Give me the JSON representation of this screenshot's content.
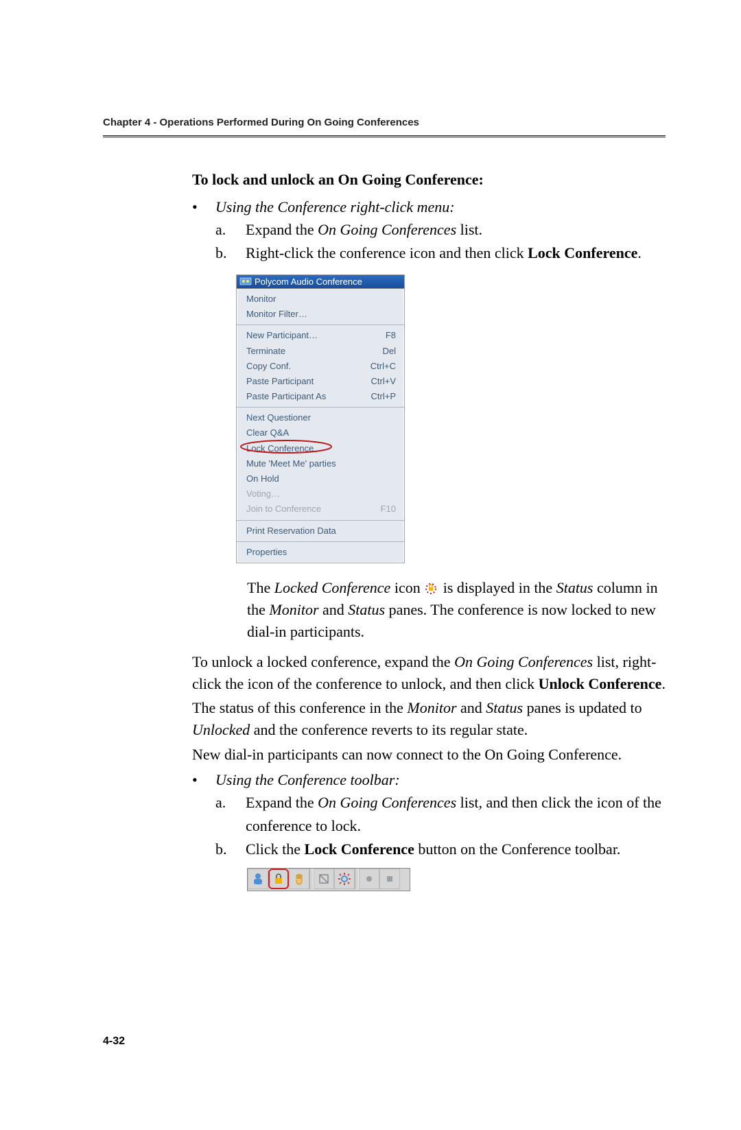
{
  "chapter_header": "Chapter 4 - Operations Performed During On Going Conferences",
  "heading": "To lock and unlock an On Going Conference:",
  "bullet1": {
    "text": "Using the Conference right-click menu:"
  },
  "stepA": {
    "label": "a.",
    "prefix": "Expand the ",
    "italic": "On Going Conferences",
    "suffix": " list."
  },
  "stepB": {
    "label": "b.",
    "prefix": "Right-click the conference icon and then click ",
    "bold": "Lock Conference",
    "suffix": "."
  },
  "menu": {
    "title": "Polycom Audio Conference",
    "sections": [
      {
        "rows": [
          {
            "label": "Monitor"
          },
          {
            "label": "Monitor Filter…"
          }
        ]
      },
      {
        "rows": [
          {
            "label": "New Participant…",
            "shortcut": "F8"
          },
          {
            "label": "Terminate",
            "shortcut": "Del"
          },
          {
            "label": "Copy Conf.",
            "shortcut": "Ctrl+C"
          },
          {
            "label": "Paste Participant",
            "shortcut": "Ctrl+V"
          },
          {
            "label": "Paste Participant As",
            "shortcut": "Ctrl+P"
          }
        ]
      },
      {
        "rows": [
          {
            "label": "Next Questioner"
          },
          {
            "label": "Clear Q&A"
          },
          {
            "label": "Lock Conference",
            "lock": true
          },
          {
            "label": "Mute 'Meet Me' parties"
          },
          {
            "label": "On Hold"
          },
          {
            "label": "Voting…",
            "disabled": true
          },
          {
            "label": "Join to Conference",
            "shortcut": "F10",
            "disabled": true
          }
        ]
      },
      {
        "rows": [
          {
            "label": "Print Reservation Data"
          }
        ]
      },
      {
        "rows": [
          {
            "label": "Properties"
          }
        ]
      }
    ]
  },
  "result_line": {
    "p1": "The ",
    "i1": "Locked Conference",
    "p2": " icon ",
    "p3": " is displayed in the ",
    "i2": "Status",
    "p4": " column in the ",
    "i3": "Monitor",
    "p5": " and ",
    "i4": "Status",
    "p6": " panes. The conference is now locked to new dial-in participants."
  },
  "para_unlock": {
    "p1": "To unlock a locked conference, expand the ",
    "i1": "On Going Conferences",
    "p2": " list, right-click the icon of the conference to unlock, and then click ",
    "b1": "Unlock Conference",
    "p3": "."
  },
  "para_status": {
    "p1": "The status of this conference in the ",
    "i1": "Monitor",
    "p2": " and ",
    "i2": "Status",
    "p3": " panes is updated to ",
    "i3": "Unlocked",
    "p4": " and the conference reverts to its regular state."
  },
  "para_new_dial": "New dial-in participants can now connect to the On Going Conference.",
  "bullet2": {
    "text": "Using the Conference toolbar:"
  },
  "stepA2": {
    "label": "a.",
    "prefix": "Expand the ",
    "italic": "On Going Conferences",
    "suffix": " list, and then click the icon of the conference to lock."
  },
  "stepB2": {
    "label": "b.",
    "prefix": "Click the ",
    "bold": "Lock Conference",
    "suffix": " button on the Conference toolbar."
  },
  "page_number": "4-32"
}
